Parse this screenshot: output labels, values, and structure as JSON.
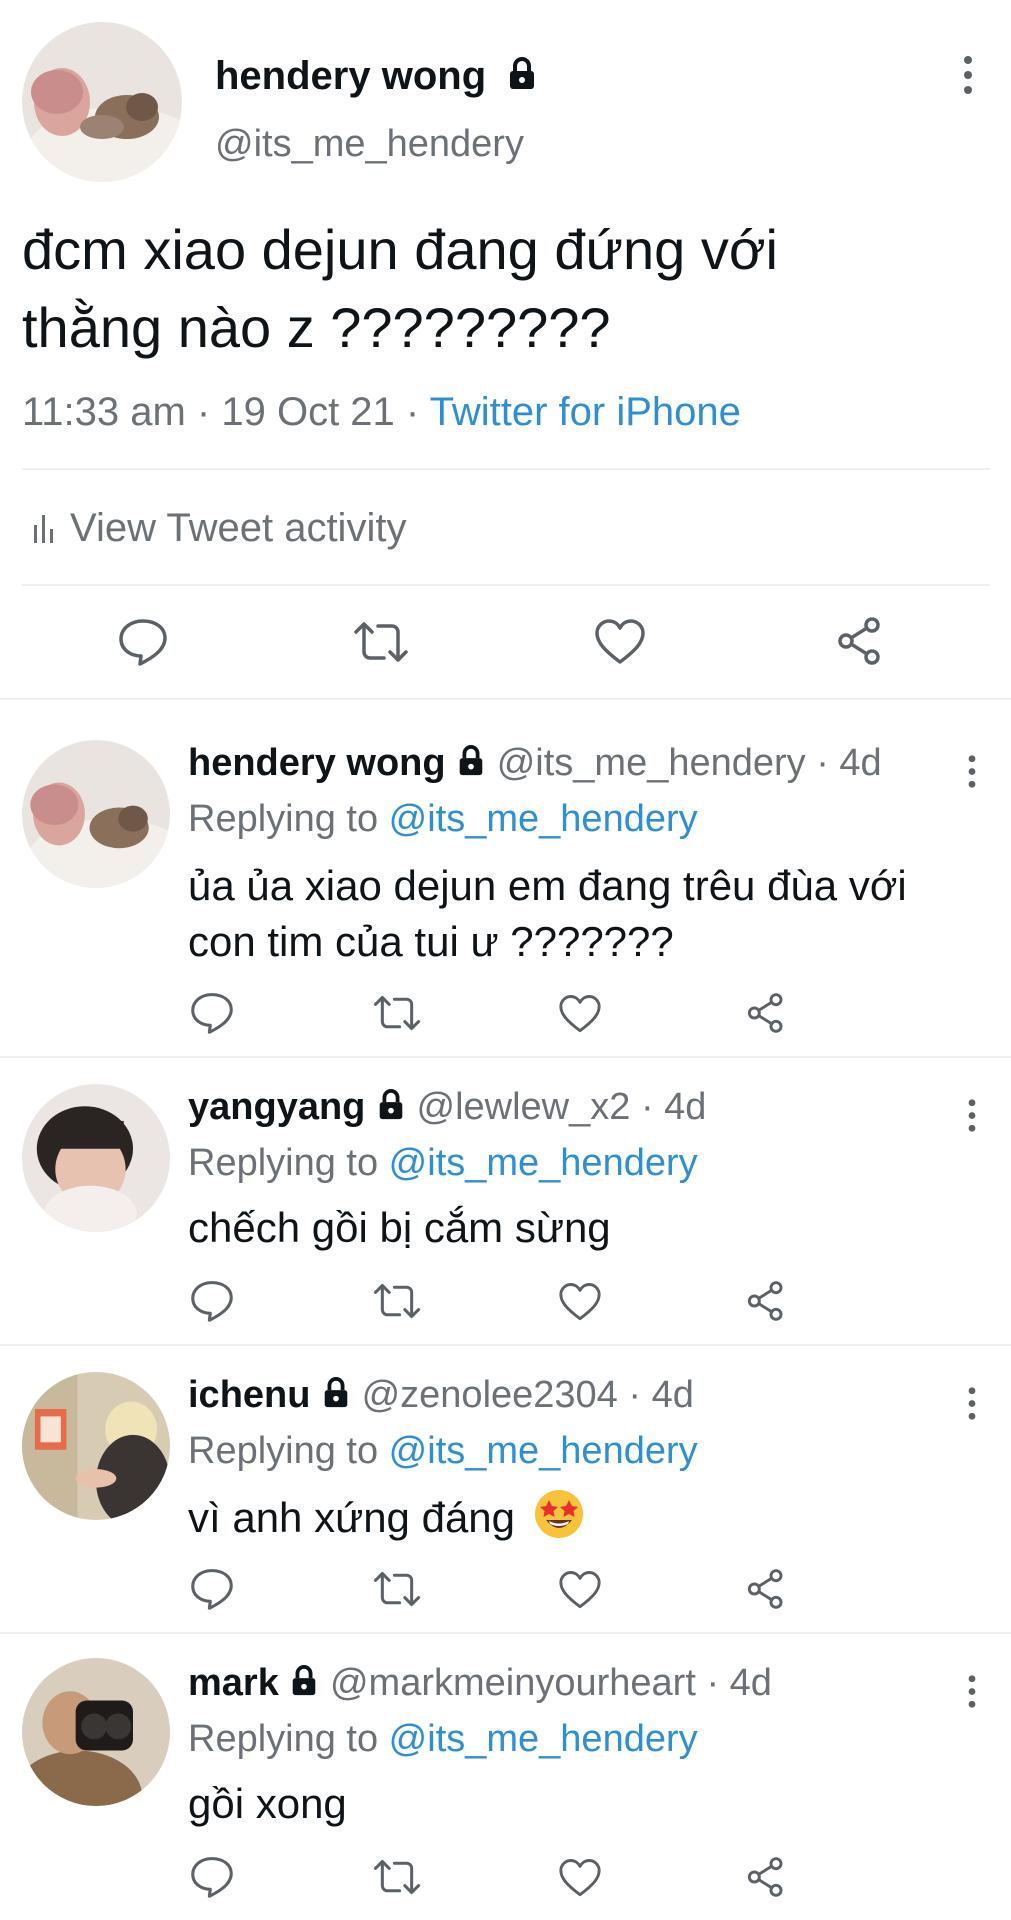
{
  "main_tweet": {
    "author_name": "hendery wong",
    "handle": "@its_me_hendery",
    "text_line1": "đcm xiao dejun đang đứng với",
    "text_line2": "thằng nào z ?????????",
    "time": "11:33 am · 19 Oct 21 · ",
    "source": "Twitter for iPhone",
    "activity_label": "View Tweet activity"
  },
  "replies": [
    {
      "author_name": "hendery wong",
      "handle_time": "@its_me_hendery · 4d",
      "replying_prefix": "Replying to ",
      "replying_handle": "@its_me_hendery",
      "text_line1": "ủa ủa xiao dejun em đang trêu đùa với",
      "text_line2": "con tim của tui ư ???????"
    },
    {
      "author_name": "yangyang",
      "handle_time": "@lewlew_x2 · 4d",
      "replying_prefix": "Replying to ",
      "replying_handle": "@its_me_hendery",
      "text_line1": "chếch gồi bị cắm sừng"
    },
    {
      "author_name": "ichenu",
      "handle_time": "@zenolee2304 · 4d",
      "replying_prefix": "Replying to ",
      "replying_handle": "@its_me_hendery",
      "text_line1": "vì anh xứng đáng",
      "emoji": "star-struck-emoji"
    },
    {
      "author_name": "mark",
      "handle_time": "@markmeinyourheart · 4d",
      "replying_prefix": "Replying to ",
      "replying_handle": "@its_me_hendery",
      "text_line1": "gồi xong"
    }
  ],
  "icons": {
    "lock": "lock-icon",
    "more": "more-vertical-icon",
    "reply": "reply-icon",
    "retweet": "retweet-icon",
    "like": "heart-icon",
    "share": "share-icon",
    "activity": "bar-chart-icon"
  },
  "colors": {
    "link": "#2f8fd0",
    "secondary_text": "#6b7177",
    "primary_text": "#0f1419",
    "divider": "#eceff1"
  }
}
